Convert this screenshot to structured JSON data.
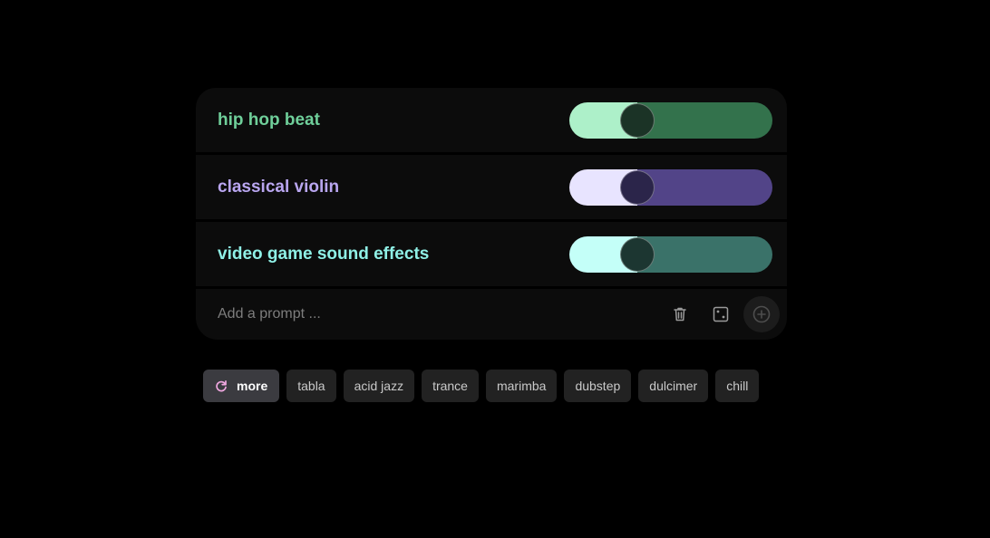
{
  "prompts": [
    {
      "label": "hip hop beat",
      "weight": 0.3,
      "colors": {
        "text": "#6fcf9a",
        "fill": "#adf0c9",
        "track": "#33724c",
        "knob": "#1b3326"
      }
    },
    {
      "label": "classical violin",
      "weight": 0.3,
      "colors": {
        "text": "#b9a6f0",
        "fill": "#e8e4ff",
        "track": "#524488",
        "knob": "#2b254a"
      }
    },
    {
      "label": "video game sound effects",
      "weight": 0.3,
      "colors": {
        "text": "#8ff0e6",
        "fill": "#c4fff8",
        "track": "#3a7269",
        "knob": "#1c3631"
      }
    }
  ],
  "input": {
    "placeholder": "Add a prompt ...",
    "value": ""
  },
  "actions": {
    "delete_icon": "trash-icon",
    "random_icon": "dice-icon",
    "add_icon": "plus-circle-icon"
  },
  "suggestions": {
    "more_label": "more",
    "more_icon": "refresh-icon",
    "more_icon_color": "#f0a8e0",
    "items": [
      "tabla",
      "acid jazz",
      "trance",
      "marimba",
      "dubstep",
      "dulcimer",
      "chill"
    ]
  }
}
